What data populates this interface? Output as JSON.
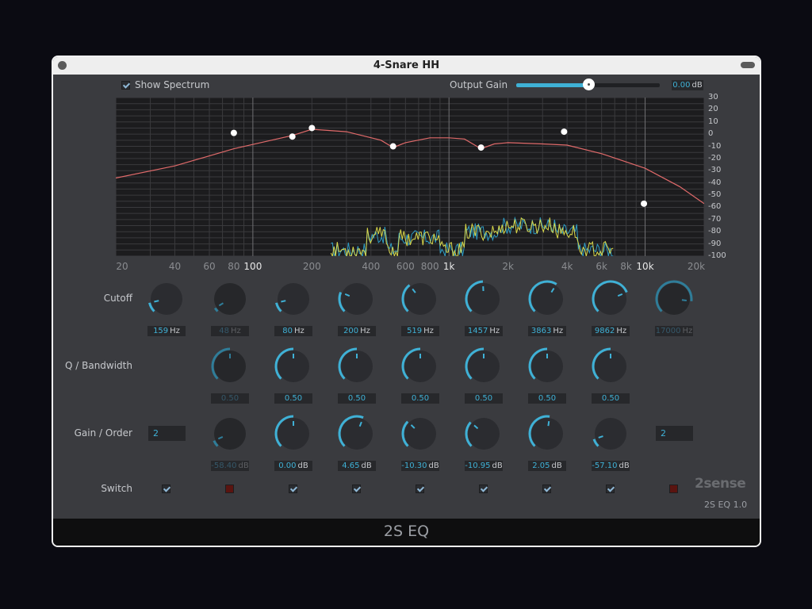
{
  "window": {
    "title": "4-Snare HH"
  },
  "footer": {
    "title": "2S EQ"
  },
  "header": {
    "show_spectrum_label": "Show Spectrum",
    "show_spectrum_checked": true,
    "output_gain_label": "Output Gain",
    "output_gain_value": "0.00",
    "output_gain_unit": "dB",
    "output_gain_level": 0.5
  },
  "rows": {
    "cutoff": "Cutoff",
    "q": "Q / Bandwidth",
    "gain": "Gain / Order",
    "switch": "Switch"
  },
  "bands": [
    {
      "cutoff": "159",
      "cutoff_unit": "Hz",
      "q": null,
      "gain": null,
      "switch": true,
      "enabled": true,
      "cut_level": 0.12
    },
    {
      "cutoff": "48",
      "cutoff_unit": "Hz",
      "q": "0.50",
      "gain": "-58.40",
      "gain_unit": "dB",
      "switch": false,
      "enabled": false,
      "cut_level": 0.05,
      "q_level": 0.5,
      "gain_level": 0.08
    },
    {
      "cutoff": "80",
      "cutoff_unit": "Hz",
      "q": "0.50",
      "gain": "0.00",
      "gain_unit": "dB",
      "switch": true,
      "enabled": true,
      "cut_level": 0.12,
      "q_level": 0.5,
      "gain_level": 0.5
    },
    {
      "cutoff": "200",
      "cutoff_unit": "Hz",
      "q": "0.50",
      "gain": "4.65",
      "gain_unit": "dB",
      "switch": true,
      "enabled": true,
      "cut_level": 0.25,
      "q_level": 0.5,
      "gain_level": 0.58
    },
    {
      "cutoff": "519",
      "cutoff_unit": "Hz",
      "q": "0.50",
      "gain": "-10.30",
      "gain_unit": "dB",
      "switch": true,
      "enabled": true,
      "cut_level": 0.36,
      "q_level": 0.5,
      "gain_level": 0.33
    },
    {
      "cutoff": "1457",
      "cutoff_unit": "Hz",
      "q": "0.50",
      "gain": "-10.95",
      "gain_unit": "dB",
      "switch": true,
      "enabled": true,
      "cut_level": 0.49,
      "q_level": 0.5,
      "gain_level": 0.32
    },
    {
      "cutoff": "3863",
      "cutoff_unit": "Hz",
      "q": "0.50",
      "gain": "2.05",
      "gain_unit": "dB",
      "switch": true,
      "enabled": true,
      "cut_level": 0.62,
      "q_level": 0.5,
      "gain_level": 0.53
    },
    {
      "cutoff": "9862",
      "cutoff_unit": "Hz",
      "q": "0.50",
      "gain": "-57.10",
      "gain_unit": "dB",
      "switch": true,
      "enabled": true,
      "cut_level": 0.75,
      "q_level": 0.5,
      "gain_level": 0.1
    },
    {
      "cutoff": "17000",
      "cutoff_unit": "Hz",
      "q": null,
      "gain": null,
      "switch": false,
      "enabled": false,
      "cut_level": 0.86
    }
  ],
  "order_left": "2",
  "order_right": "2",
  "brand": {
    "logo": "2sense",
    "version": "2S EQ   1.0"
  },
  "graph": {
    "x_ticks": [
      {
        "l": "20",
        "f": 20
      },
      {
        "l": "40",
        "f": 40
      },
      {
        "l": "60",
        "f": 60
      },
      {
        "l": "80",
        "f": 80
      },
      {
        "l": "100",
        "f": 100,
        "major": true
      },
      {
        "l": "200",
        "f": 200
      },
      {
        "l": "400",
        "f": 400
      },
      {
        "l": "600",
        "f": 600
      },
      {
        "l": "800",
        "f": 800
      },
      {
        "l": "1k",
        "f": 1000,
        "major": true
      },
      {
        "l": "2k",
        "f": 2000
      },
      {
        "l": "4k",
        "f": 4000
      },
      {
        "l": "6k",
        "f": 6000
      },
      {
        "l": "8k",
        "f": 8000
      },
      {
        "l": "10k",
        "f": 10000,
        "major": true
      },
      {
        "l": "20k",
        "f": 20000
      }
    ],
    "y_ticks": [
      "30",
      "20",
      "10",
      "0",
      "-10",
      "-20",
      "-30",
      "-40",
      "-50",
      "-60",
      "-70",
      "-80",
      "-90",
      "-100"
    ],
    "y_min": -100,
    "y_max": 30,
    "response": [
      [
        20,
        -36
      ],
      [
        40,
        -26
      ],
      [
        80,
        -12
      ],
      [
        160,
        -1
      ],
      [
        200,
        4
      ],
      [
        300,
        2
      ],
      [
        450,
        -5
      ],
      [
        519,
        -11
      ],
      [
        600,
        -7
      ],
      [
        800,
        -3
      ],
      [
        1000,
        -3
      ],
      [
        1200,
        -4
      ],
      [
        1457,
        -12
      ],
      [
        1700,
        -8
      ],
      [
        2000,
        -7
      ],
      [
        3000,
        -8
      ],
      [
        4000,
        -9
      ],
      [
        6000,
        -16
      ],
      [
        10000,
        -28
      ],
      [
        15000,
        -43
      ],
      [
        20000,
        -57
      ]
    ],
    "nodes": [
      [
        80,
        1
      ],
      [
        159,
        -2
      ],
      [
        200,
        5
      ],
      [
        519,
        -10
      ],
      [
        1457,
        -11
      ],
      [
        3863,
        2
      ],
      [
        9862,
        -57
      ]
    ]
  }
}
